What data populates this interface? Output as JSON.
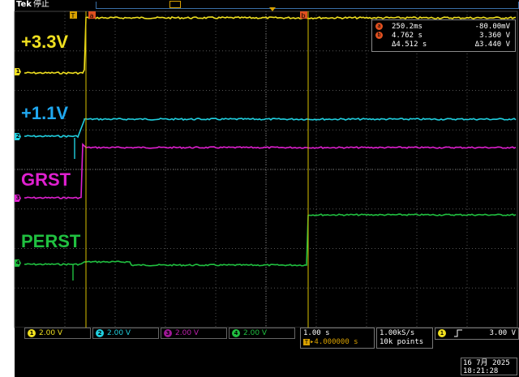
{
  "header": {
    "brand": "Tek",
    "status": "停止"
  },
  "labels": {
    "v33": "+3.3V",
    "v11": "+1.1V",
    "grst": "GRST",
    "perst": "PERST"
  },
  "cursor_readout": {
    "a": {
      "icon": "a",
      "time": "250.2ms",
      "value": "-80.00mV"
    },
    "b": {
      "icon": "b",
      "time": "4.762 s",
      "value": "3.360 V"
    },
    "delta": {
      "time": "Δ4.512 s",
      "value": "Δ3.440 V"
    }
  },
  "markers": {
    "trigger_position": "T",
    "cursor_a": "a",
    "cursor_b": "b"
  },
  "channels": [
    {
      "num": "1",
      "scale": "2.00 V",
      "color": "#f0e020"
    },
    {
      "num": "2",
      "scale": "2.00 V",
      "color": "#20d0e0"
    },
    {
      "num": "3",
      "scale": "2.00 V",
      "color": "#e020d0"
    },
    {
      "num": "4",
      "scale": "2.00 V",
      "color": "#20c040"
    }
  ],
  "timebase": {
    "scale": "1.00 s",
    "delay": "▸4.000000 s"
  },
  "acquisition": {
    "rate": "1.00kS/s",
    "record": "10k points"
  },
  "trigger": {
    "source": "1",
    "level": "3.00 V"
  },
  "datetime": {
    "date": "16 7月  2025",
    "time": "18:21:28"
  },
  "colors": {
    "ch1": "#f0e020",
    "ch2": "#20d0e0",
    "ch3": "#e020d0",
    "ch4": "#20c040",
    "cursor": "#e05020",
    "grid": "#555555"
  },
  "icons": {
    "trigger_slope": "rising-edge-icon"
  }
}
